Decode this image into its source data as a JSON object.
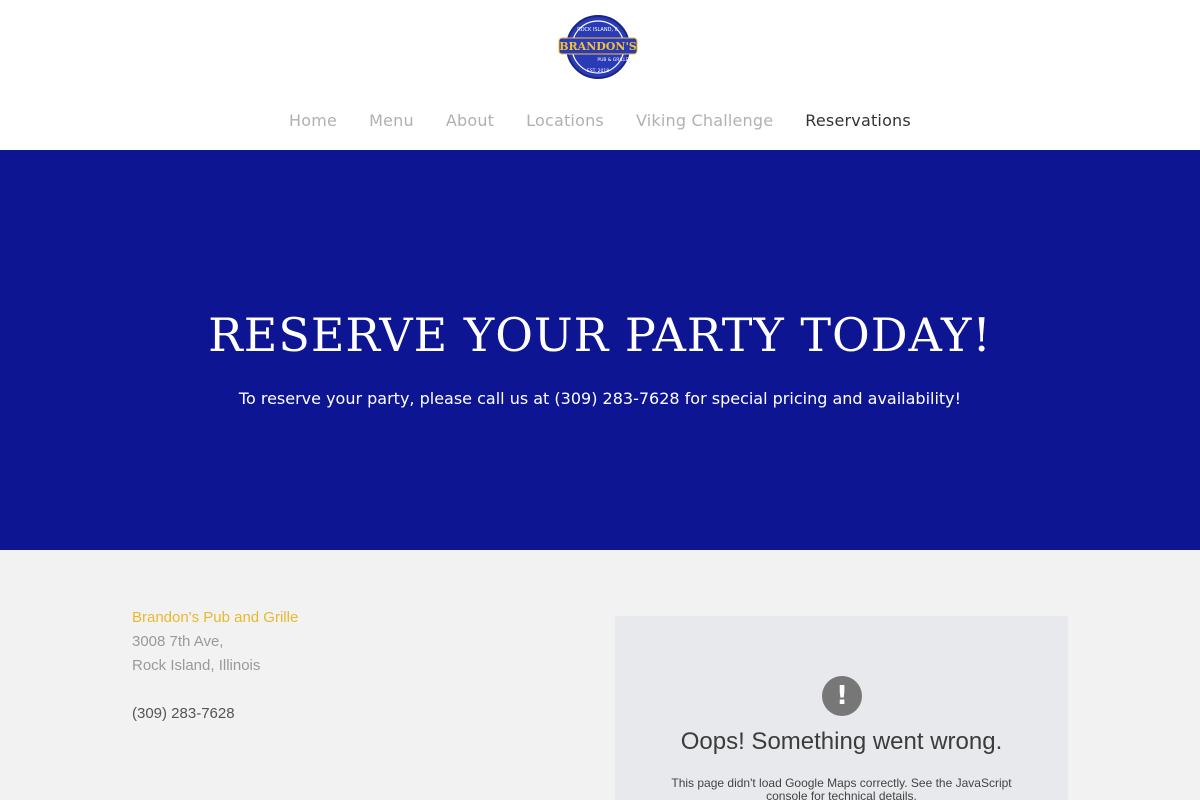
{
  "header": {
    "logo": {
      "top_text": "ROCK ISLAND, IL",
      "name": "BRANDON'S",
      "sub": "PUB & GRILLE",
      "est": "EST. 2018"
    },
    "nav": [
      {
        "label": "Home",
        "active": false
      },
      {
        "label": "Menu",
        "active": false
      },
      {
        "label": "About",
        "active": false
      },
      {
        "label": "Locations",
        "active": false
      },
      {
        "label": "Viking Challenge",
        "active": false
      },
      {
        "label": "Reservations",
        "active": true
      }
    ]
  },
  "hero": {
    "title": "RESERVE YOUR PARTY TODAY!",
    "subtitle": "To reserve your party, please call us at (309) 283-7628 for special pricing and availability!"
  },
  "contact": {
    "business_name": "Brandon's Pub and Grille",
    "address_line1": "3008 7th Ave,",
    "address_line2": "Rock Island, Illinois",
    "phone": "(309) 283-7628"
  },
  "map_error": {
    "icon_glyph": "!",
    "title": "Oops! Something went wrong.",
    "message": "This page didn't load Google Maps correctly. See the JavaScript console for technical details."
  },
  "colors": {
    "hero_bg": "#0e1593",
    "accent_gold": "#e8b92f",
    "logo_blue": "#2b3bb8"
  }
}
